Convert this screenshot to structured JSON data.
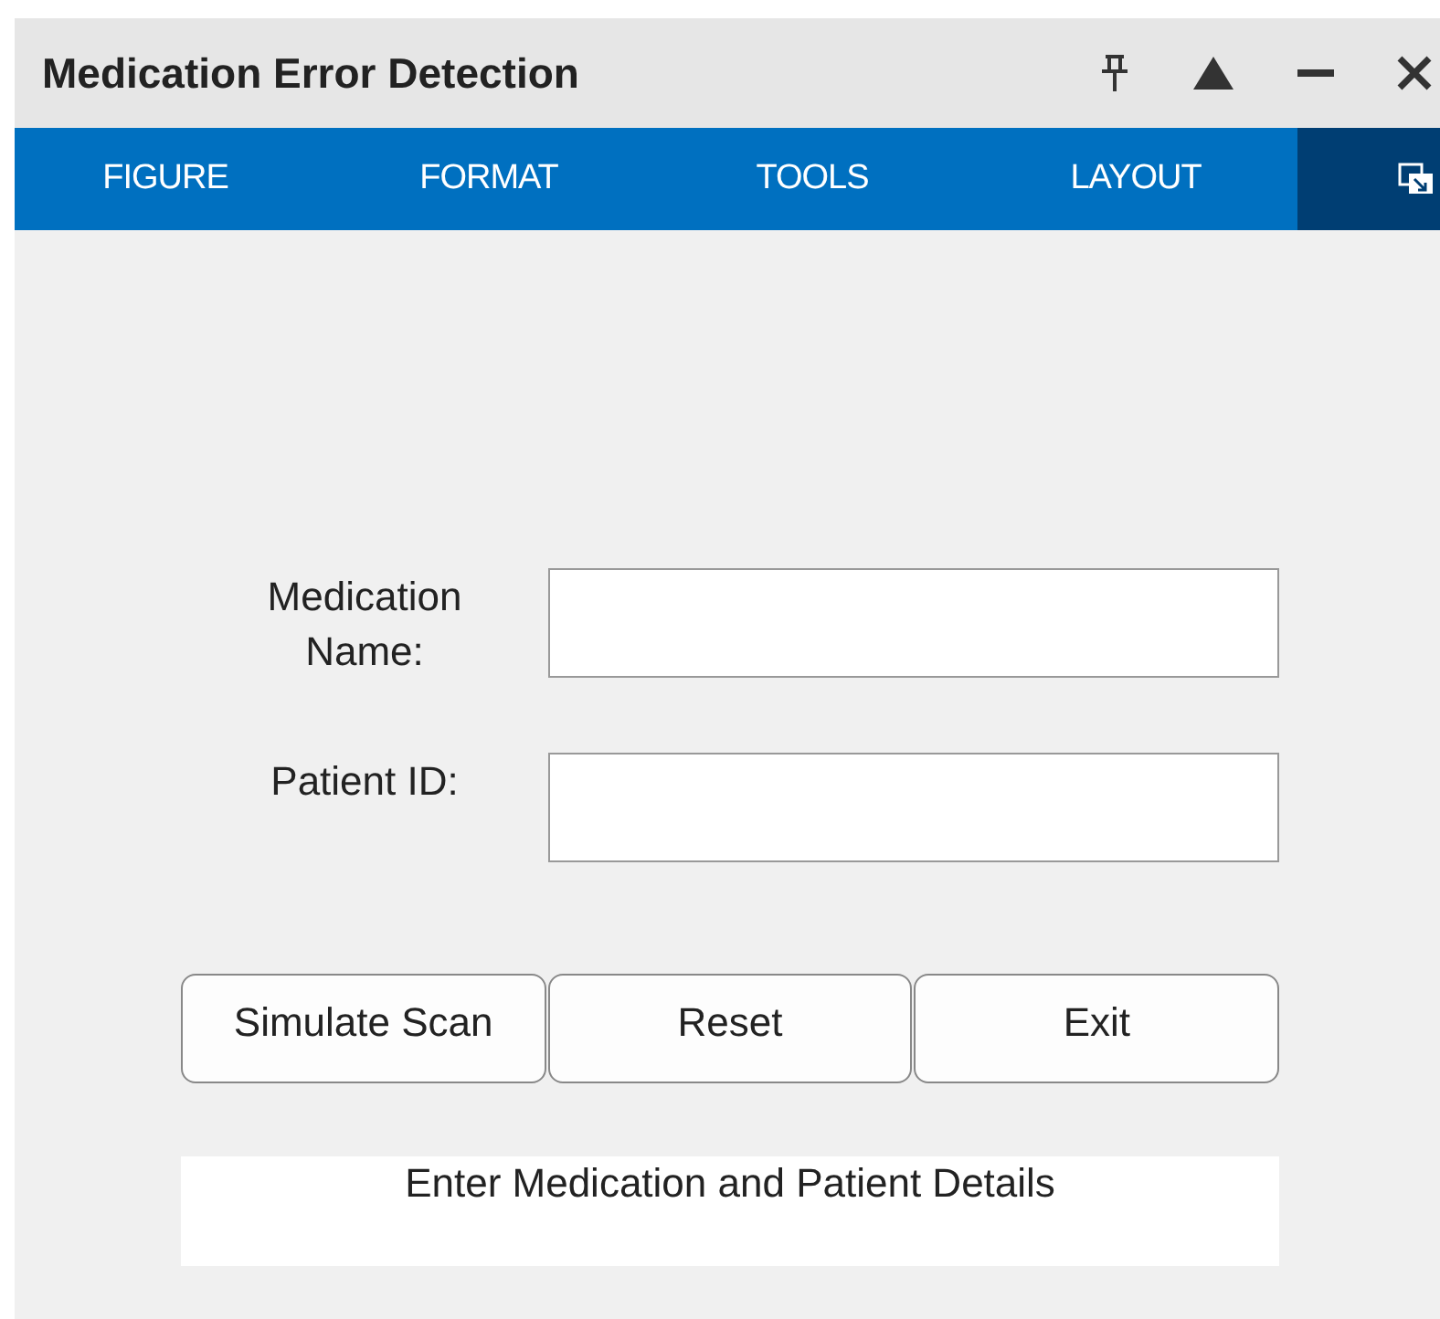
{
  "window": {
    "title": "Medication Error Detection"
  },
  "toolbar": {
    "tabs": [
      {
        "label": "FIGURE"
      },
      {
        "label": "FORMAT"
      },
      {
        "label": "TOOLS"
      },
      {
        "label": "LAYOUT"
      }
    ]
  },
  "form": {
    "fields": [
      {
        "label": "Medication\nName:"
      },
      {
        "label": "Patient ID:"
      }
    ],
    "buttons": [
      "Simulate Scan",
      "Reset",
      "Exit"
    ],
    "status": "Enter Medication and Patient Details"
  }
}
